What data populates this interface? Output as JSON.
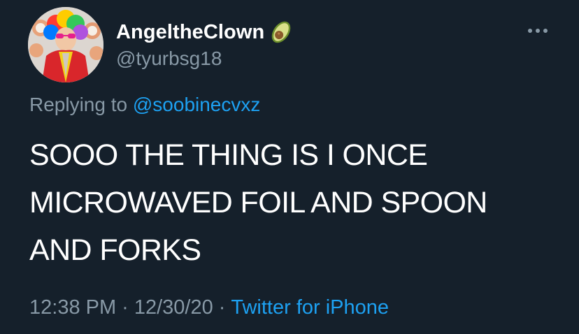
{
  "user": {
    "display_name": "AngeltheClown",
    "emoji_icon": "avocado-icon",
    "handle": "@tyurbsg18"
  },
  "reply": {
    "prefix": "Replying to",
    "mention": "@soobinecvxz"
  },
  "tweet": {
    "lines": [
      "SOOO THE THING IS I ONCE",
      "MICROWAVED FOIL AND SPOON",
      "AND FORKS"
    ]
  },
  "meta": {
    "time": "12:38 PM",
    "separator": "·",
    "date": "12/30/20",
    "source": "Twitter for iPhone"
  },
  "colors": {
    "background": "#15202b",
    "text": "#ffffff",
    "secondary": "#8899a6",
    "link": "#1da1f2"
  },
  "icons": {
    "more": "more-options-icon"
  }
}
